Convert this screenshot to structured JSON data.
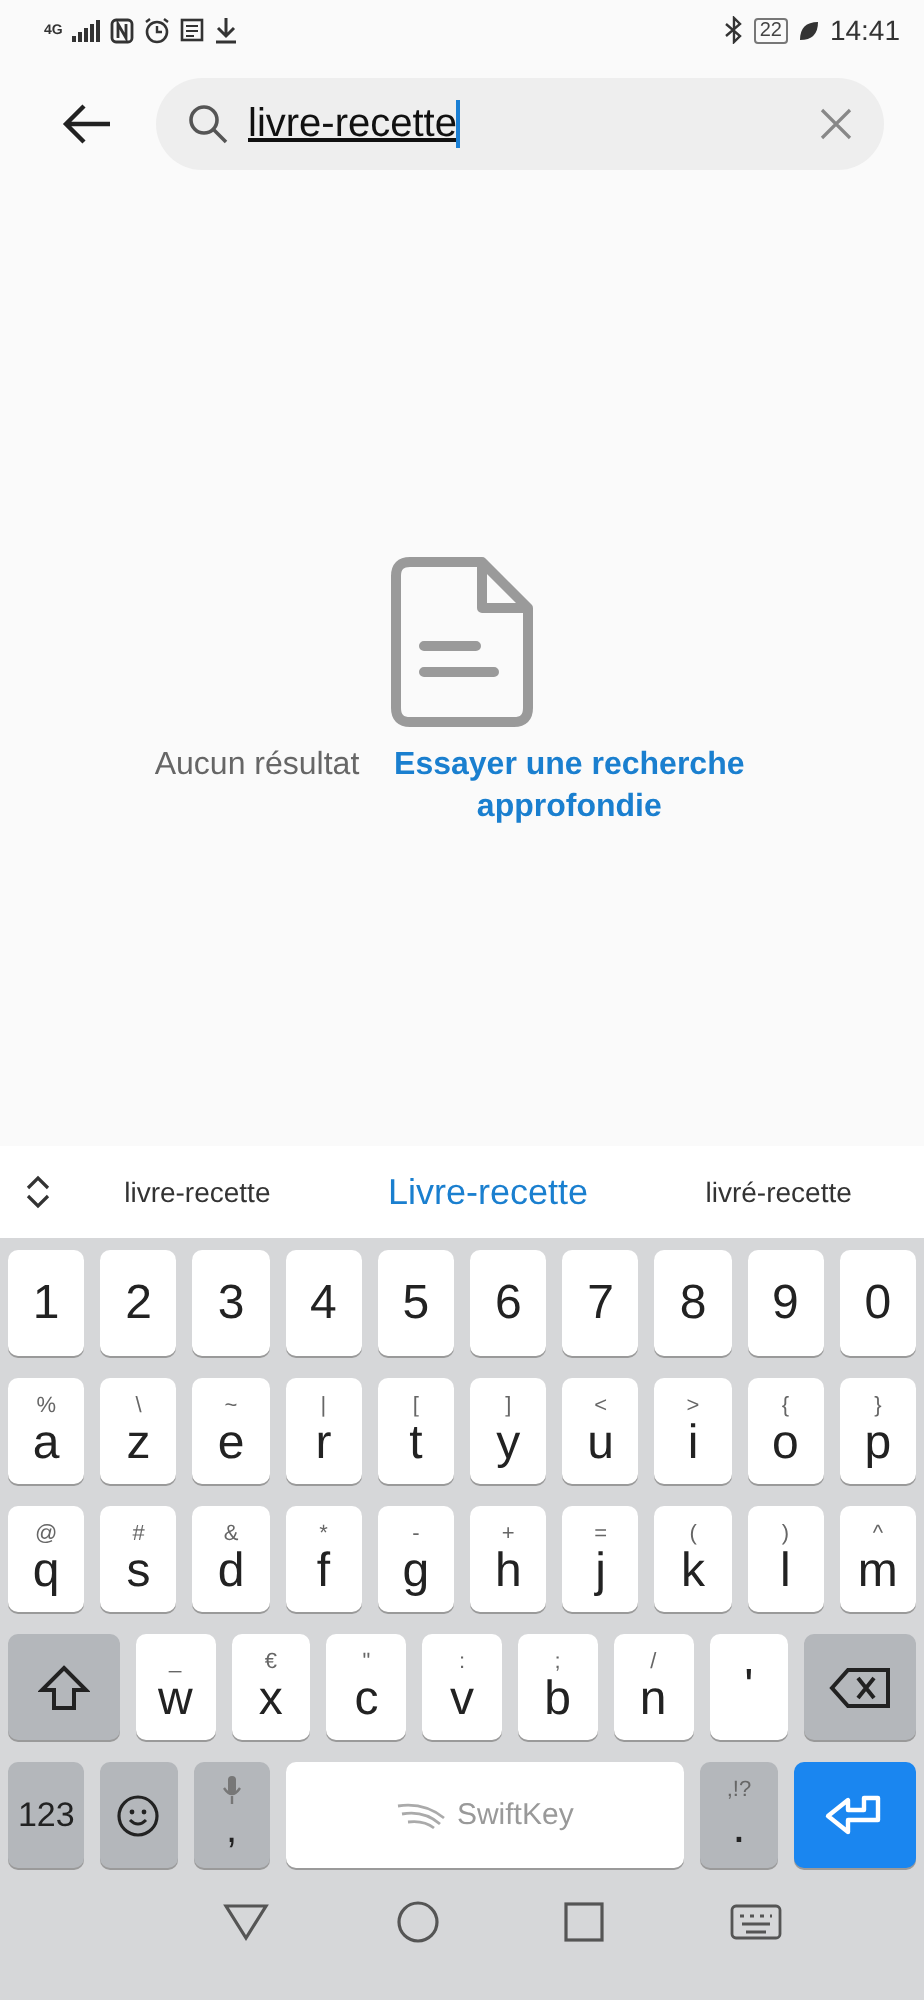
{
  "status_bar": {
    "network": "4G",
    "battery": "22",
    "time": "14:41"
  },
  "search": {
    "value": "livre-recette"
  },
  "empty_state": {
    "message": "Aucun résultat",
    "link": "Essayer une recherche approfondie"
  },
  "suggestions": [
    {
      "text": "livre-recette",
      "selected": false
    },
    {
      "text": "Livre-recette",
      "selected": true
    },
    {
      "text": "livré-recette",
      "selected": false
    }
  ],
  "keyboard": {
    "rows": [
      {
        "keys": [
          {
            "kind": "char",
            "label": "1"
          },
          {
            "kind": "char",
            "label": "2"
          },
          {
            "kind": "char",
            "label": "3"
          },
          {
            "kind": "char",
            "label": "4"
          },
          {
            "kind": "char",
            "label": "5"
          },
          {
            "kind": "char",
            "label": "6"
          },
          {
            "kind": "char",
            "label": "7"
          },
          {
            "kind": "char",
            "label": "8"
          },
          {
            "kind": "char",
            "label": "9"
          },
          {
            "kind": "char",
            "label": "0"
          }
        ]
      },
      {
        "keys": [
          {
            "kind": "char",
            "label": "a",
            "hint": "%"
          },
          {
            "kind": "char",
            "label": "z",
            "hint": "\\"
          },
          {
            "kind": "char",
            "label": "e",
            "hint": "~"
          },
          {
            "kind": "char",
            "label": "r",
            "hint": "|"
          },
          {
            "kind": "char",
            "label": "t",
            "hint": "["
          },
          {
            "kind": "char",
            "label": "y",
            "hint": "]"
          },
          {
            "kind": "char",
            "label": "u",
            "hint": "<"
          },
          {
            "kind": "char",
            "label": "i",
            "hint": ">"
          },
          {
            "kind": "char",
            "label": "o",
            "hint": "{"
          },
          {
            "kind": "char",
            "label": "p",
            "hint": "}"
          }
        ]
      },
      {
        "keys": [
          {
            "kind": "char",
            "label": "q",
            "hint": "@"
          },
          {
            "kind": "char",
            "label": "s",
            "hint": "#"
          },
          {
            "kind": "char",
            "label": "d",
            "hint": "&"
          },
          {
            "kind": "char",
            "label": "f",
            "hint": "*"
          },
          {
            "kind": "char",
            "label": "g",
            "hint": "-"
          },
          {
            "kind": "char",
            "label": "h",
            "hint": "+"
          },
          {
            "kind": "char",
            "label": "j",
            "hint": "="
          },
          {
            "kind": "char",
            "label": "k",
            "hint": "("
          },
          {
            "kind": "char",
            "label": "l",
            "hint": ")"
          },
          {
            "kind": "char",
            "label": "m",
            "hint": "^"
          }
        ]
      },
      {
        "keys": [
          {
            "kind": "shift"
          },
          {
            "kind": "char",
            "label": "w",
            "hint": "_"
          },
          {
            "kind": "char",
            "label": "x",
            "hint": "€"
          },
          {
            "kind": "char",
            "label": "c",
            "hint": "\""
          },
          {
            "kind": "char",
            "label": "v",
            "hint": ":"
          },
          {
            "kind": "char",
            "label": "b",
            "hint": ";"
          },
          {
            "kind": "char",
            "label": "n",
            "hint": "/"
          },
          {
            "kind": "char",
            "label": "'"
          },
          {
            "kind": "backspace"
          }
        ]
      },
      {
        "keys": [
          {
            "kind": "mode",
            "label": "123"
          },
          {
            "kind": "emoji"
          },
          {
            "kind": "mic",
            "label": ","
          },
          {
            "kind": "space",
            "label": "SwiftKey"
          },
          {
            "kind": "punct",
            "label": ".",
            "hint": ",!?"
          },
          {
            "kind": "enter"
          }
        ]
      }
    ]
  }
}
